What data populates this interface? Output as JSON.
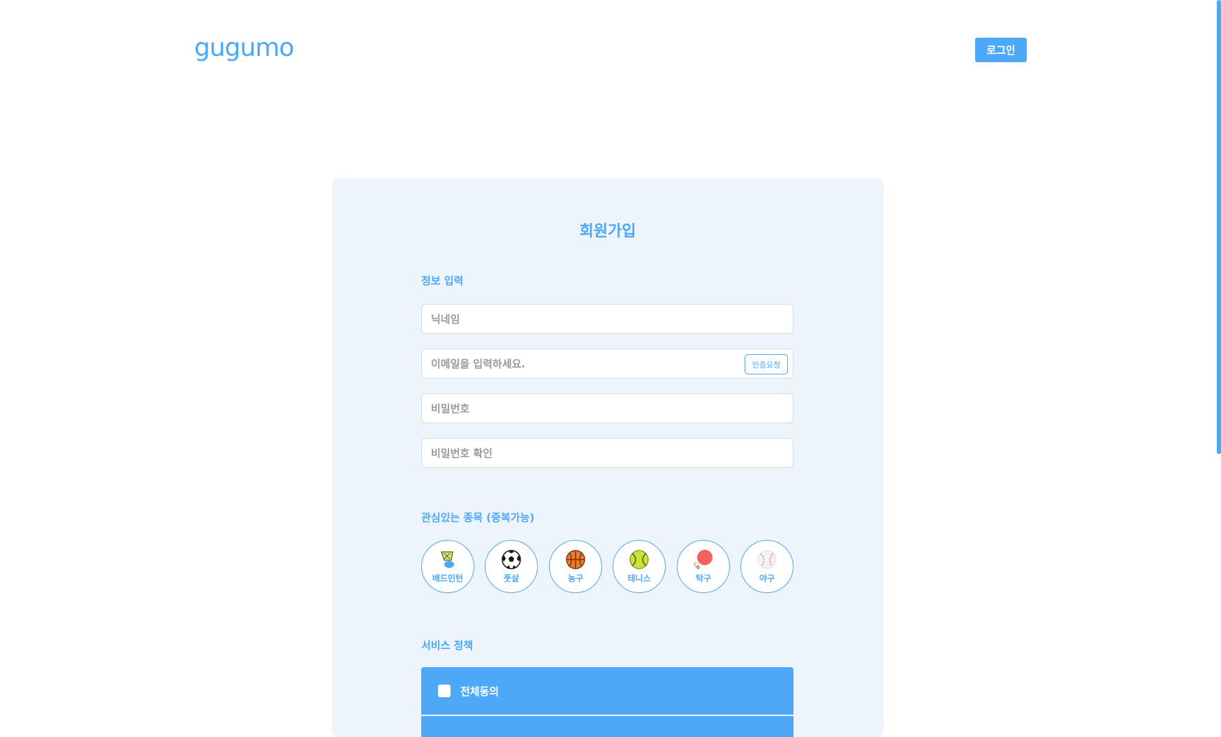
{
  "header": {
    "logo_text": "gugumo",
    "login_label": "로그인"
  },
  "signup": {
    "title": "회원가입",
    "info_section_label": "정보 입력",
    "nickname_placeholder": "닉네임",
    "email_placeholder": "이메일을 입력하세요.",
    "verify_button_label": "인증요청",
    "password_placeholder": "비밀번호",
    "password_confirm_placeholder": "비밀번호 확인",
    "sports_section_label": "관심있는 종목 (중복가능)",
    "sports": [
      {
        "label": "배드민턴",
        "icon": "shuttlecock-icon"
      },
      {
        "label": "풋살",
        "icon": "soccer-ball-icon"
      },
      {
        "label": "농구",
        "icon": "basketball-icon"
      },
      {
        "label": "테니스",
        "icon": "tennis-ball-icon"
      },
      {
        "label": "탁구",
        "icon": "ping-pong-paddle-icon"
      },
      {
        "label": "야구",
        "icon": "baseball-icon"
      }
    ],
    "policy_section_label": "서비스 정책",
    "agree_all_label": "전체동의"
  },
  "colors": {
    "accent": "#4da8f8",
    "card_background": "#edf4fc"
  }
}
